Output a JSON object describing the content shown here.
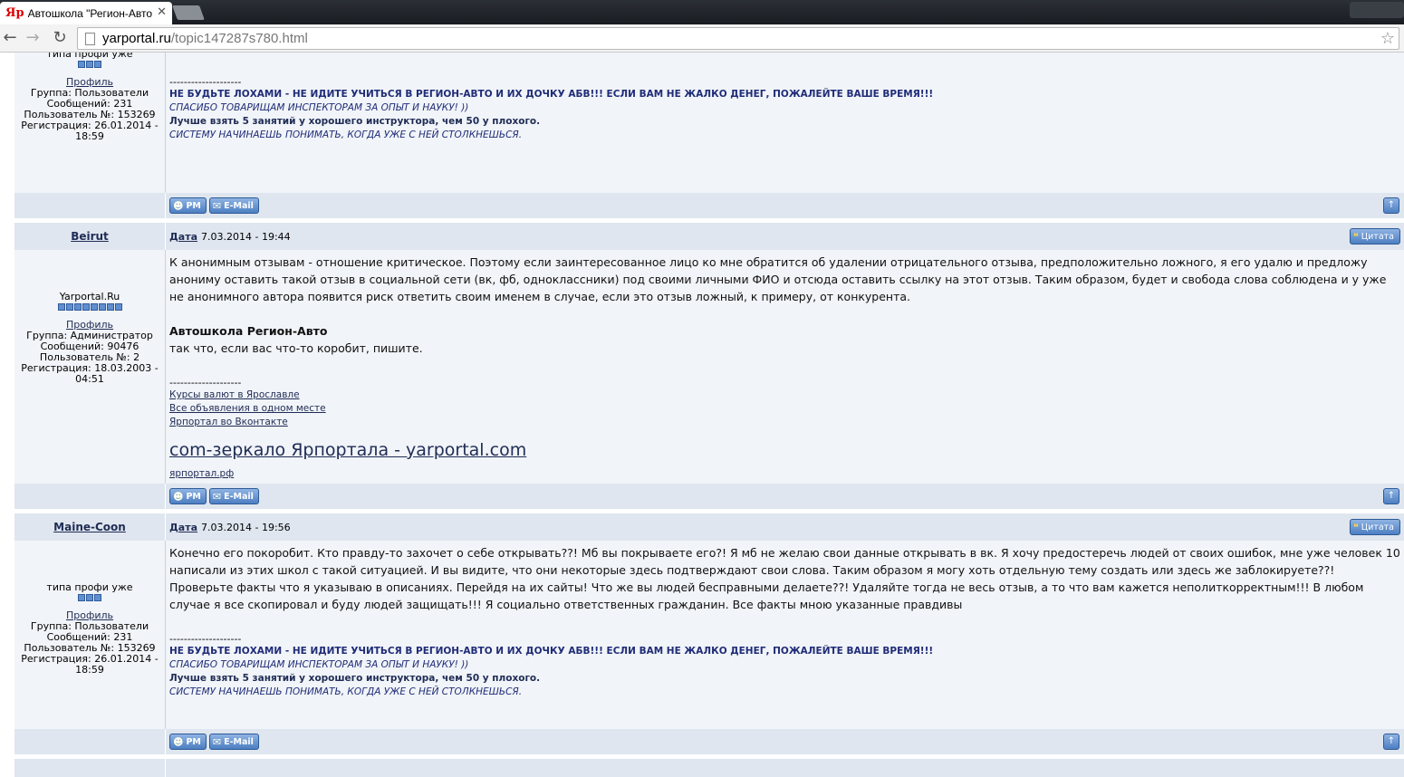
{
  "browser": {
    "tab_favicon": "Яр",
    "tab_title": "Автошкола \"Регион-Авто",
    "tab_close": "✕",
    "url_host": "yarportal.ru",
    "url_path": "/topic147287s780.html"
  },
  "signature": {
    "sep": "--------------------",
    "line1": "НЕ БУДЬТЕ ЛОХАМИ - НЕ ИДИТЕ УЧИТЬСЯ В РЕГИОН-АВТО И ИХ ДОЧКУ АБВ!!! ЕСЛИ ВАМ НЕ ЖАЛКО ДЕНЕГ, ПОЖАЛЕЙТЕ ВАШЕ ВРЕМЯ!!!",
    "line2": "СПАСИБО ТОВАРИЩАМ ИНСПЕКТОРАМ ЗА ОПЫТ И НАУКУ! ))",
    "line3": "Лучше взять 5 занятий у хорошего инструктора, чем 50 у плохого.",
    "line4": "СИСТЕМУ НАЧИНАЕШЬ ПОНИМАТЬ, КОГДА УЖЕ С НЕЙ СТОЛКНЕШЬСЯ."
  },
  "buttons": {
    "pm": "PM",
    "email": "E-Mail",
    "quote": "Цитата",
    "up": "↑"
  },
  "labels": {
    "date": "Дата",
    "profile": "Профиль"
  },
  "post0": {
    "rank": "типа профи уже",
    "group": "Группа: Пользователи",
    "messages": "Сообщений: 231",
    "user_no": "Пользователь №: 153269",
    "reg": "Регистрация: 26.01.2014 -",
    "reg_time": "18:59"
  },
  "post1": {
    "author": "Beirut",
    "date": "7.03.2014 - 19:44",
    "rank": "Yarportal.Ru",
    "group": "Группа: Администратор",
    "messages": "Сообщений: 90476",
    "user_no": "Пользователь №: 2",
    "reg": "Регистрация: 18.03.2003 -",
    "reg_time": "04:51",
    "text": "К анонимным отзывам - отношение критическое. Поэтому если заинтересованное лицо ко мне обратится об удалении отрицательного отзыва, предположительно ложного, я его удалю и предложу анониму оставить такой отзыв в социальной сети (вк, фб, одноклассники) под своими личными ФИО и отсюда оставить ссылку на этот отзыв. Таким образом, будет и свобода слова соблюдена и у уже не анонимного автора появится риск ответить своим именем в случае, если это отзыв ложный, к примеру, от конкурента.",
    "subtitle": "Автошкола Регион-Авто",
    "text2": "так что, если вас что-то коробит, пишите.",
    "sig_sep": "--------------------",
    "link1": "Курсы валют в Ярославле",
    "link2": "Все объявления в одном месте",
    "link3": "Ярпортал во Вконтакте",
    "big_link": "com-зеркало Ярпортала - yarportal.com",
    "link4": "ярпортал.рф"
  },
  "post2": {
    "author": "Maine-Coon",
    "date": "7.03.2014 - 19:56",
    "rank": "типа профи уже",
    "group": "Группа: Пользователи",
    "messages": "Сообщений: 231",
    "user_no": "Пользователь №: 153269",
    "reg": "Регистрация: 26.01.2014 -",
    "reg_time": "18:59",
    "text": "Конечно его покоробит. Кто правду-то захочет о себе открывать??! Мб вы покрываете его?! Я мб не желаю свои данные открывать в вк. Я хочу предостеречь людей от своих ошибок, мне уже человек 10 написали из этих школ с такой ситуацией. И вы видите, что они некоторые здесь подтверждают свои слова. Таким образом я могу хоть отдельную тему создать или здесь же заблокируете??! Проверьте факты что я указываю в описаниях. Перейдя на их сайты! Что же вы людей бесправными делаете??! Удаляйте тогда не весь отзыв, а то что вам кажется неполиткорректным!!! В любом случае я все скопировал и буду людей защищать!!! Я социально ответственных гражданин. Все факты мною указанные правдивы"
  },
  "colors": {
    "header_bg": "#dfe6ef",
    "body_bg": "#f1f4f8",
    "link": "#1f2c55",
    "button_blue": "#4d7fc2"
  },
  "icons": {
    "back": "back-arrow-icon",
    "forward": "forward-arrow-icon",
    "reload": "reload-icon",
    "star": "star-icon",
    "pm": "users-icon",
    "email": "envelope-icon",
    "quote": "speech-bubble-icon",
    "up": "arrow-up-icon"
  }
}
